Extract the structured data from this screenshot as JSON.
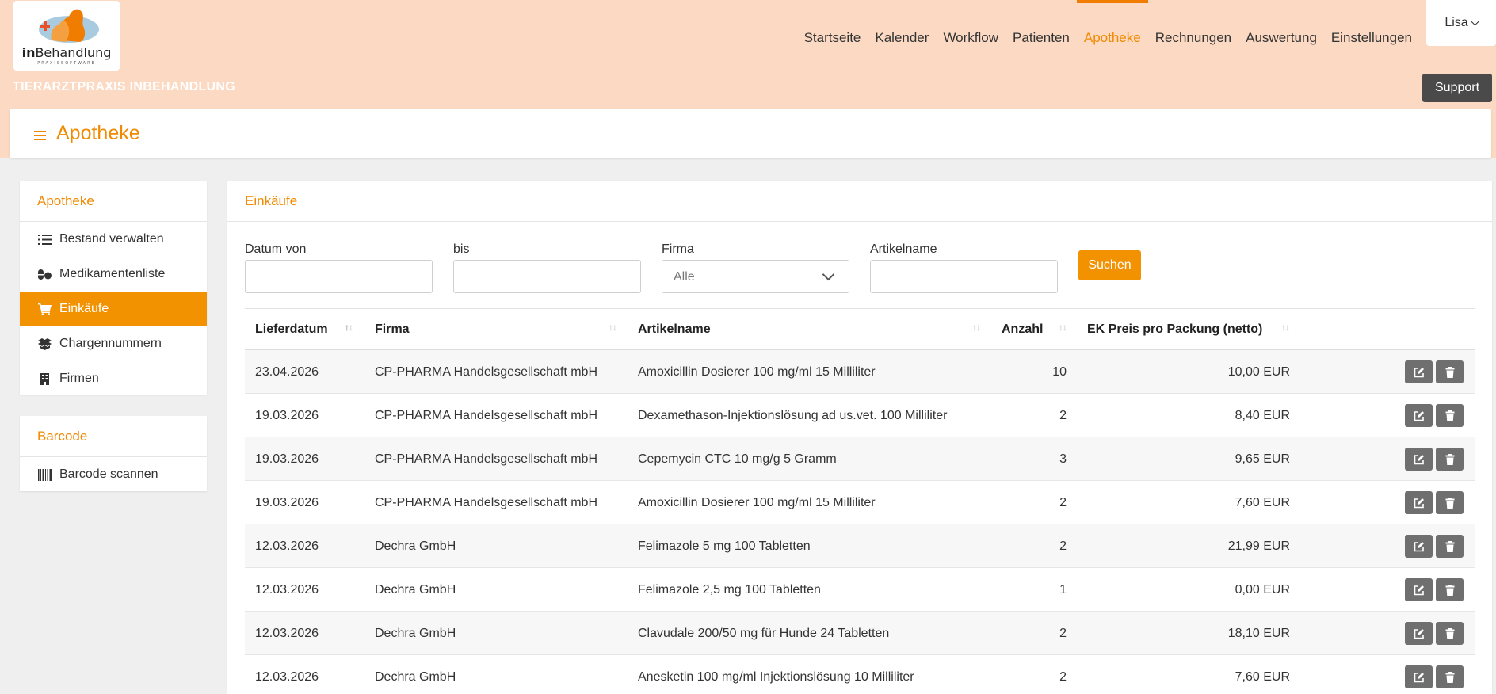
{
  "brand": {
    "logo_word_bold": "in",
    "logo_word_rest": "Behandlung",
    "logo_tagline": "PRAXISSOFTWARE",
    "practice_name": "TIERARZTPRAXIS INBEHANDLUNG"
  },
  "nav": {
    "items": [
      {
        "label": "Startseite"
      },
      {
        "label": "Kalender"
      },
      {
        "label": "Workflow"
      },
      {
        "label": "Patienten"
      },
      {
        "label": "Apotheke"
      },
      {
        "label": "Rechnungen"
      },
      {
        "label": "Auswertung"
      },
      {
        "label": "Einstellungen"
      }
    ],
    "active": "Apotheke",
    "user_label": "Lisa",
    "support_label": "Support"
  },
  "page": {
    "title": "Apotheke"
  },
  "sidebar": {
    "sections": [
      {
        "title": "Apotheke",
        "items": [
          {
            "label": "Bestand verwalten",
            "icon": "list-icon"
          },
          {
            "label": "Medikamentenliste",
            "icon": "pills-icon"
          },
          {
            "label": "Einkäufe",
            "icon": "cart-icon",
            "active": true
          },
          {
            "label": "Chargennummern",
            "icon": "boxes-icon"
          },
          {
            "label": "Firmen",
            "icon": "building-icon"
          }
        ]
      },
      {
        "title": "Barcode",
        "items": [
          {
            "label": "Barcode scannen",
            "icon": "barcode-icon"
          }
        ]
      }
    ]
  },
  "main": {
    "title": "Einkäufe",
    "filters": {
      "date_from_label": "Datum von",
      "date_from_value": "",
      "date_to_label": "bis",
      "date_to_value": "",
      "company_label": "Firma",
      "company_selected": "Alle",
      "article_label": "Artikelname",
      "article_value": "",
      "search_label": "Suchen"
    },
    "table": {
      "columns": [
        "Lieferdatum",
        "Firma",
        "Artikelname",
        "Anzahl",
        "EK Preis pro Packung (netto)"
      ],
      "rows": [
        [
          "23.04.2026",
          "CP-PHARMA Handelsgesellschaft mbH",
          "Amoxicillin Dosierer 100 mg/ml 15 Milliliter",
          "10",
          "10,00 EUR"
        ],
        [
          "19.03.2026",
          "CP-PHARMA Handelsgesellschaft mbH",
          "Dexamethason-Injektionslösung ad us.vet. 100 Milliliter",
          "2",
          "8,40 EUR"
        ],
        [
          "19.03.2026",
          "CP-PHARMA Handelsgesellschaft mbH",
          "Cepemycin CTC 10 mg/g 5 Gramm",
          "3",
          "9,65 EUR"
        ],
        [
          "19.03.2026",
          "CP-PHARMA Handelsgesellschaft mbH",
          "Amoxicillin Dosierer 100 mg/ml 15 Milliliter",
          "2",
          "7,60 EUR"
        ],
        [
          "12.03.2026",
          "Dechra GmbH",
          "Felimazole 5 mg 100 Tabletten",
          "2",
          "21,99 EUR"
        ],
        [
          "12.03.2026",
          "Dechra GmbH",
          "Felimazole 2,5 mg 100 Tabletten",
          "1",
          "0,00 EUR"
        ],
        [
          "12.03.2026",
          "Dechra GmbH",
          "Clavudale 200/50 mg für Hunde 24 Tabletten",
          "2",
          "18,10 EUR"
        ],
        [
          "12.03.2026",
          "Dechra GmbH",
          "Anesketin 100 mg/ml Injektionslösung 10 Milliliter",
          "2",
          "7,60 EUR"
        ]
      ]
    }
  },
  "colors": {
    "accent": "#f39200",
    "header_bg": "#fbd9c2",
    "button_dark": "#4a4a4a"
  }
}
